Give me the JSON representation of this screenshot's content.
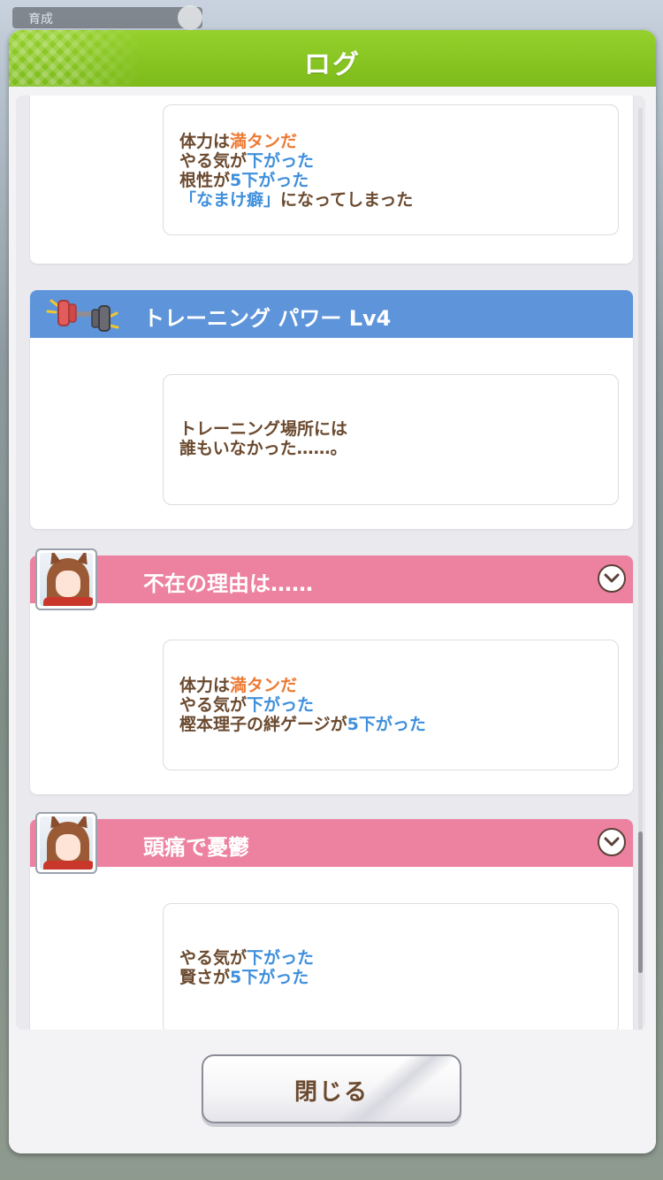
{
  "background": {
    "chip_text": "育成"
  },
  "dialog": {
    "title": "ログ",
    "close_label": "閉じる"
  },
  "entries": [
    {
      "type": "effects",
      "lines": [
        [
          {
            "t": "体力は"
          },
          {
            "t": "満タンだ",
            "c": "orange"
          }
        ],
        [
          {
            "t": "やる気が"
          },
          {
            "t": "下がった",
            "c": "blue"
          }
        ],
        [
          {
            "t": "根性が"
          },
          {
            "t": "5下がった",
            "c": "blue"
          }
        ],
        [
          {
            "t": "「なまけ癖」",
            "c": "blue"
          },
          {
            "t": "になってしまった"
          }
        ]
      ]
    },
    {
      "type": "training",
      "band_color": "blue",
      "title": "トレーニング パワー Lv4",
      "icon": "dumbbell-icon",
      "lines": [
        [
          {
            "t": "トレーニング場所には"
          }
        ],
        [
          {
            "t": "誰もいなかった……。"
          }
        ]
      ]
    },
    {
      "type": "event",
      "band_color": "pink",
      "title": "不在の理由は……",
      "icon": "character-portrait",
      "lines": [
        [
          {
            "t": "体力は"
          },
          {
            "t": "満タンだ",
            "c": "orange"
          }
        ],
        [
          {
            "t": "やる気が"
          },
          {
            "t": "下がった",
            "c": "blue"
          }
        ],
        [
          {
            "t": "樫本理子の絆ゲージが"
          },
          {
            "t": "5下がった",
            "c": "blue"
          }
        ]
      ]
    },
    {
      "type": "event",
      "band_color": "pink",
      "title": "頭痛で憂鬱",
      "icon": "character-portrait",
      "lines": [
        [
          {
            "t": "やる気が"
          },
          {
            "t": "下がった",
            "c": "blue"
          }
        ],
        [
          {
            "t": "賢さが"
          },
          {
            "t": "5下がった",
            "c": "blue"
          }
        ]
      ]
    }
  ],
  "colors": {
    "header_green": "#7cbb1a",
    "band_blue": "#5d94da",
    "band_pink": "#ec81a0",
    "text_brown": "#6b4a2f",
    "highlight_orange": "#ee7a34",
    "highlight_blue": "#3f8fdc"
  }
}
